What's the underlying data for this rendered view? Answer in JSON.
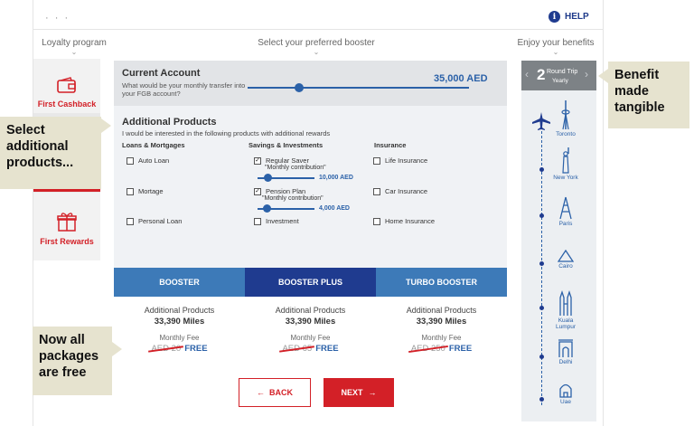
{
  "header": {
    "logo_stub": "· · ·",
    "help_label": "HELP"
  },
  "steps": [
    {
      "label": "Loyalty program"
    },
    {
      "label": "Select your preferred booster"
    },
    {
      "label": "Enjoy your benefits"
    }
  ],
  "left_tabs": [
    {
      "label": "First Cashback",
      "icon": "wallet-icon"
    },
    {
      "label": "First Rewards",
      "icon": "gift-icon"
    }
  ],
  "current_account": {
    "title": "Current Account",
    "question": "What would be your monthly transfer into your FGB account?",
    "amount": "35,000 AED",
    "slider_level_percent": 25
  },
  "additional_products": {
    "title": "Additional Products",
    "subtitle": "I would be interested in the following products with additional rewards",
    "columns": [
      {
        "heading": "Loans & Mortgages",
        "items": [
          {
            "label": "Auto Loan",
            "checked": false
          },
          {
            "label": "Mortage",
            "checked": false
          },
          {
            "label": "Personal Loan",
            "checked": false
          }
        ]
      },
      {
        "heading": "Savings & Investments",
        "items": [
          {
            "label": "Regular Saver",
            "checked": true,
            "note": "\"Monthly contribution\"",
            "value": "10,000 AED"
          },
          {
            "label": "Pension Plan",
            "checked": true,
            "note": "\"Monthly contribution\"",
            "value": "4,000 AED"
          },
          {
            "label": "Investment",
            "checked": false
          }
        ]
      },
      {
        "heading": "Insurance",
        "items": [
          {
            "label": "Life Insurance",
            "checked": false
          },
          {
            "label": "Car Insurance",
            "checked": false
          },
          {
            "label": "Home Insurance",
            "checked": false
          }
        ]
      }
    ]
  },
  "packages": [
    {
      "name": "BOOSTER",
      "line1": "Additional Products",
      "miles": "33,390 Miles",
      "fee_label": "Monthly Fee",
      "old_fee": "AED 20",
      "new_fee": "FREE",
      "color": "#3d7ab8"
    },
    {
      "name": "BOOSTER PLUS",
      "line1": "Additional Products",
      "miles": "33,390 Miles",
      "fee_label": "Monthly Fee",
      "old_fee": "AED 65",
      "new_fee": "FREE",
      "color": "#1f3b8f"
    },
    {
      "name": "TURBO BOOSTER",
      "line1": "Additional Products",
      "miles": "33,390 Miles",
      "fee_label": "Monthly Fee",
      "old_fee": "AED 250",
      "new_fee": "FREE",
      "color": "#3d7ab8"
    }
  ],
  "buttons": {
    "back": "BACK",
    "next": "NEXT"
  },
  "benefit": {
    "count": "2",
    "trip": "Round Trip",
    "period": "Yearly"
  },
  "cities": [
    "Toronto",
    "New York",
    "Paris",
    "Cairo",
    "Kuala Lumpur",
    "Delhi",
    "Uae"
  ],
  "callouts": {
    "select": "Select additional products...",
    "free": "Now all packages are free",
    "tangible": "Benefit made tangible"
  },
  "colors": {
    "brand_red": "#d32027",
    "brand_blue": "#2b61a8",
    "navy": "#1f3b8f"
  }
}
